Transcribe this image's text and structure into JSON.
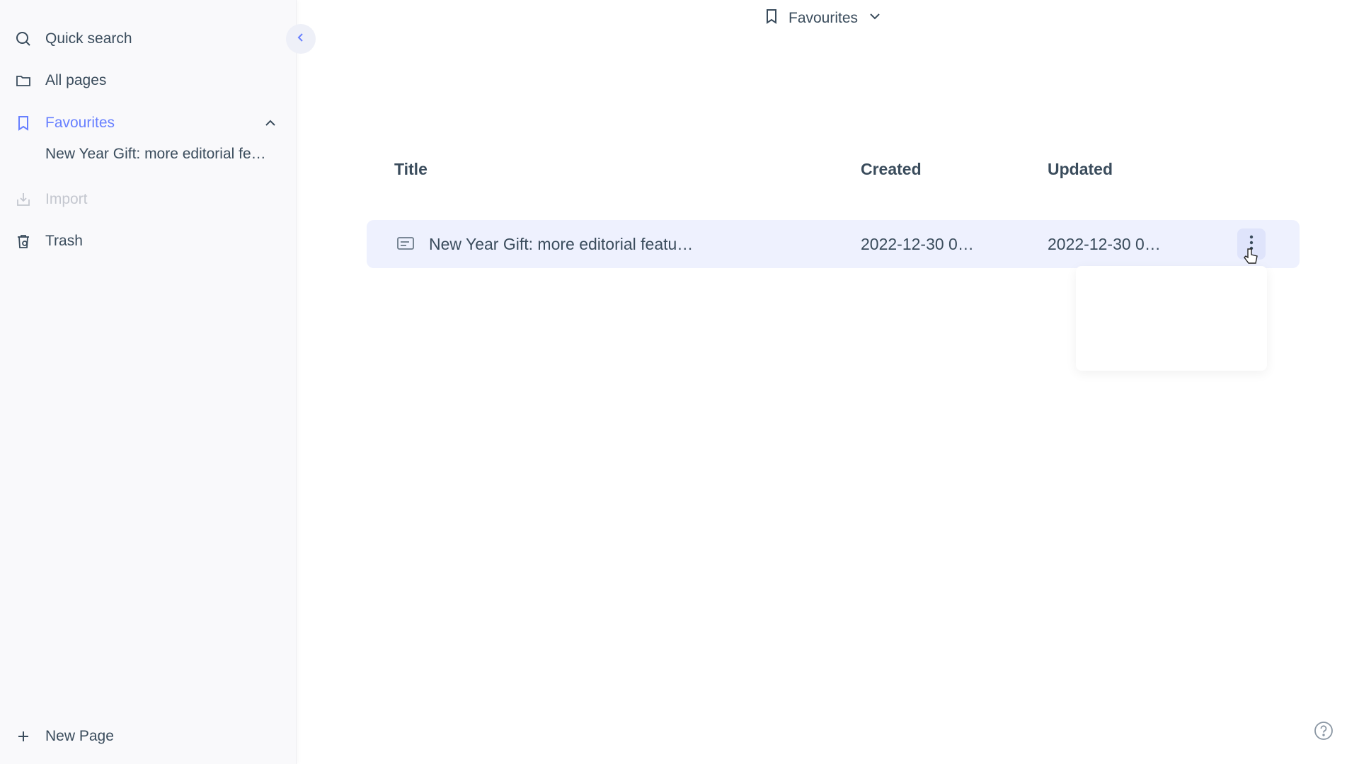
{
  "sidebar": {
    "items": [
      {
        "label": "Quick search",
        "icon": "search-icon"
      },
      {
        "label": "All pages",
        "icon": "folder-icon"
      },
      {
        "label": "Favourites",
        "icon": "bookmark-icon"
      },
      {
        "label": "Import",
        "icon": "import-icon"
      },
      {
        "label": "Trash",
        "icon": "trash-icon"
      }
    ],
    "favourite_child": "New Year Gift: more editorial fe…",
    "new_page_label": "New Page"
  },
  "header": {
    "title": "Favourites"
  },
  "table": {
    "columns": [
      "Title",
      "Created",
      "Updated"
    ],
    "rows": [
      {
        "title": "New Year Gift: more editorial featu…",
        "created": "2022-12-30 0…",
        "updated": "2022-12-30 0…"
      }
    ]
  },
  "colors": {
    "accent": "#6880ff",
    "text": "#3a4c5c",
    "row_highlight": "#eef1fe"
  }
}
